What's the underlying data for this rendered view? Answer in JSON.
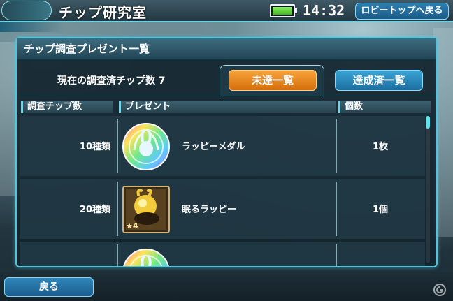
{
  "header": {
    "title": "チップ研究室",
    "clock": "14:32",
    "lobby_button": "ロビートップへ戻る"
  },
  "panel": {
    "title": "チップ調査プレゼント一覧",
    "count_label": "現在の調査済チップ数 7",
    "tabs": {
      "unachieved": "未達一覧",
      "achieved": "達成済一覧"
    },
    "columns": {
      "chips": "調査チップ数",
      "present": "プレゼント",
      "count": "個数"
    },
    "rows": [
      {
        "chips": "10種類",
        "name": "ラッピーメダル",
        "qty": "1枚",
        "icon": "rappy-medal-icon"
      },
      {
        "chips": "20種類",
        "name": "眠るラッピー",
        "qty": "1個",
        "icon": "sleeping-rappy-card-icon",
        "card_stars": "★4"
      },
      {
        "chips": "",
        "name": "",
        "qty": "",
        "icon": "rappy-medal-icon"
      }
    ]
  },
  "footer": {
    "back_button": "戻る"
  },
  "colors": {
    "accent": "#4fc6e0",
    "tab_active": "#e8851f",
    "tab_inactive": "#2a86bb",
    "battery": "#5cd23a"
  }
}
